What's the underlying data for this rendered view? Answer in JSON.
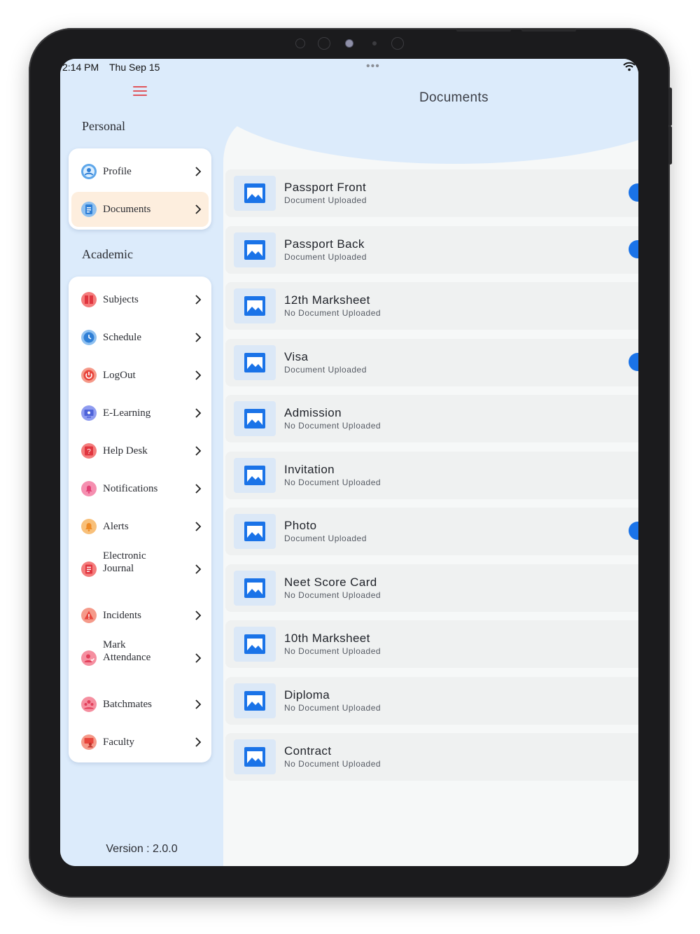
{
  "status_bar": {
    "time": "2:14 PM",
    "date": "Thu Sep 15",
    "dots": "•••"
  },
  "sidebar": {
    "menu_icon": "hamburger-icon",
    "personal_label": "Personal",
    "academic_label": "Academic",
    "personal_items": [
      {
        "label": "Profile",
        "icon": "profile-icon",
        "active": false
      },
      {
        "label": "Documents",
        "icon": "documents-icon",
        "active": true
      }
    ],
    "academic_items": [
      {
        "label": "Subjects",
        "icon": "subjects-icon"
      },
      {
        "label": "Schedule",
        "icon": "schedule-icon"
      },
      {
        "label": "LogOut",
        "icon": "logout-icon"
      },
      {
        "label": "E-Learning",
        "icon": "e-learning-icon"
      },
      {
        "label": "Help Desk",
        "icon": "help-desk-icon"
      },
      {
        "label": "Notifications",
        "icon": "notifications-icon"
      },
      {
        "label": "Alerts",
        "icon": "alerts-icon"
      },
      {
        "label_line1": "Electronic",
        "label_line2": "Journal",
        "icon": "electronic-journal-icon"
      },
      {
        "label": "Incidents",
        "icon": "incidents-icon"
      },
      {
        "label_line1": "Mark",
        "label_line2": "Attendance",
        "icon": "mark-attendance-icon"
      },
      {
        "label": "Batchmates",
        "icon": "batchmates-icon"
      },
      {
        "label": "Faculty",
        "icon": "faculty-icon"
      }
    ],
    "version": "Version :  2.0.0"
  },
  "main": {
    "title": "Documents",
    "documents": [
      {
        "title": "Passport Front",
        "status": "Document Uploaded",
        "uploaded": true
      },
      {
        "title": "Passport Back",
        "status": "Document Uploaded",
        "uploaded": true
      },
      {
        "title": "12th Marksheet",
        "status": "No Document Uploaded",
        "uploaded": false
      },
      {
        "title": "Visa",
        "status": "Document Uploaded",
        "uploaded": true
      },
      {
        "title": "Admission",
        "status": "No Document Uploaded",
        "uploaded": false
      },
      {
        "title": "Invitation",
        "status": "No Document Uploaded",
        "uploaded": false
      },
      {
        "title": "Photo",
        "status": "Document Uploaded",
        "uploaded": true
      },
      {
        "title": "Neet Score Card",
        "status": "No Document Uploaded",
        "uploaded": false
      },
      {
        "title": "10th Marksheet",
        "status": "No Document Uploaded",
        "uploaded": false
      },
      {
        "title": "Diploma",
        "status": "No Document Uploaded",
        "uploaded": false
      },
      {
        "title": "Contract",
        "status": "No Document Uploaded",
        "uploaded": false
      }
    ]
  },
  "colors": {
    "accent": "#1a73e8",
    "sidebar_bg": "#dcebfb",
    "active_item_bg": "#fdeede",
    "hamburger": "#e0555c"
  }
}
